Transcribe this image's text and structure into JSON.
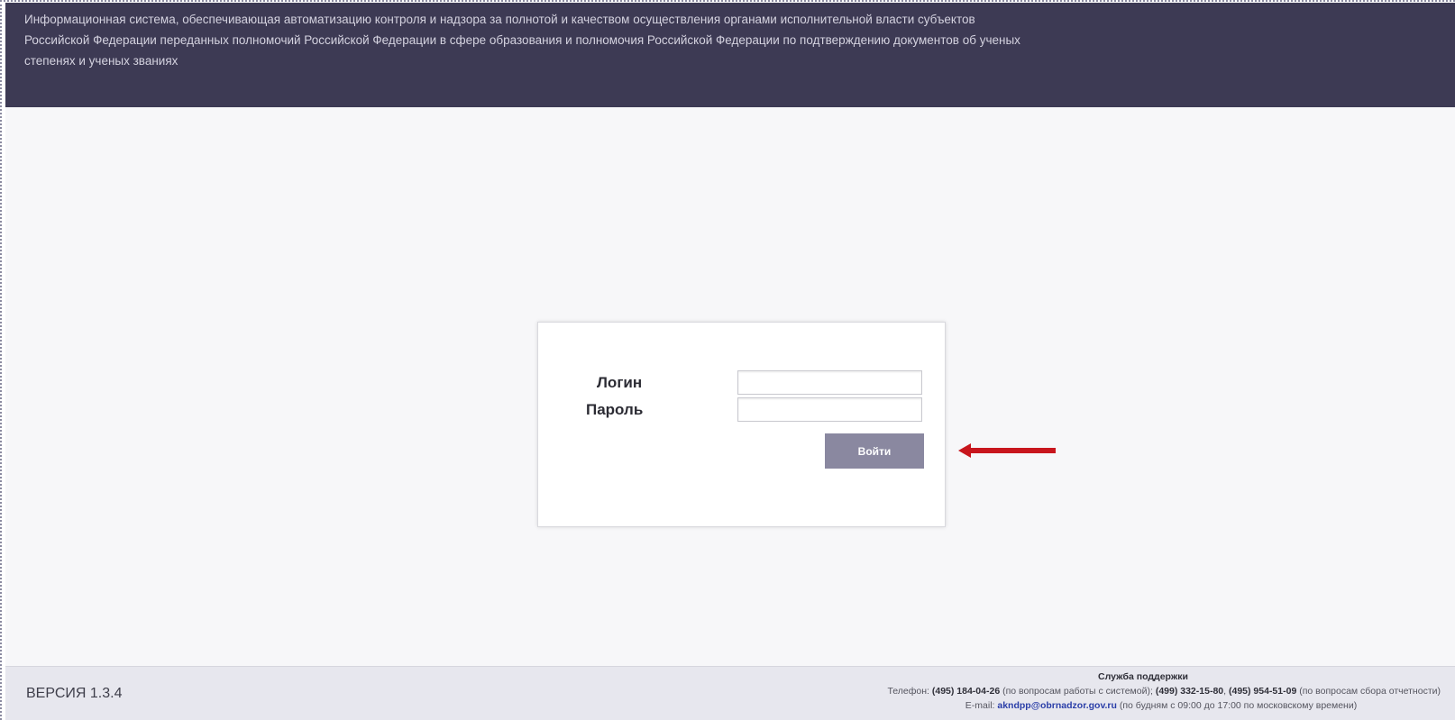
{
  "header": {
    "description": "Информационная система, обеспечивающая автоматизацию контроля и надзора за полнотой и качеством осуществления органами исполнительной власти субъектов Российской Федерации переданных полномочий Российской Федерации в сфере образования и полномочия Российской Федерации по подтверждению документов об ученых степенях и ученых званиях"
  },
  "login_form": {
    "login_label": "Логин",
    "password_label": "Пароль",
    "login_value": "",
    "password_value": "",
    "submit_label": "Войти"
  },
  "annotation": {
    "arrow_color": "#c8161d",
    "arrow_target": "submit-button"
  },
  "footer": {
    "version": "ВЕРСИЯ 1.3.4",
    "support_title": "Служба поддержки",
    "phone_prefix": "Телефон:",
    "phone_1": "(495) 184-04-26",
    "phone_1_note": "(по вопросам работы с системой);",
    "phone_2": "(499) 332-15-80",
    "phone_sep": ",",
    "phone_3": "(495) 954-51-09",
    "phone_3_note": "(по вопросам сбора отчетности)",
    "email_prefix": "E-mail:",
    "email": "akndpp@obrnadzor.gov.ru",
    "email_note": "(по будням с 09:00 до 17:00 по московскому времени)"
  },
  "colors": {
    "header_bg": "#3d3a54",
    "button_bg": "#8a88a0",
    "footer_bg": "#e7e7ee"
  }
}
